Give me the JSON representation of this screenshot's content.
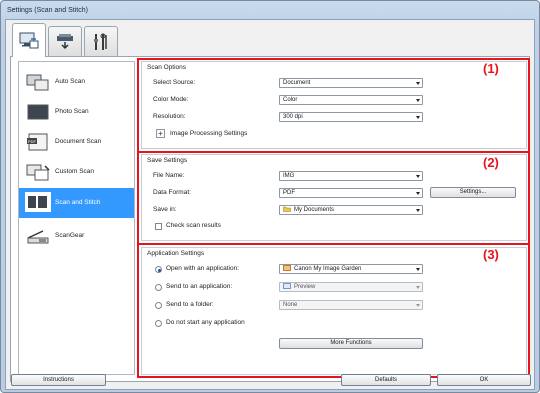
{
  "window": {
    "title": "Settings (Scan and Stitch)"
  },
  "tabs": [
    {
      "icon": "scan-from-computer-icon"
    },
    {
      "icon": "scan-from-panel-icon"
    },
    {
      "icon": "general-settings-icon"
    }
  ],
  "sidebar": {
    "items": [
      {
        "label": "Auto Scan",
        "icon": "auto-scan-icon"
      },
      {
        "label": "Photo Scan",
        "icon": "photo-scan-icon"
      },
      {
        "label": "Document Scan",
        "icon": "document-scan-icon"
      },
      {
        "label": "Custom Scan",
        "icon": "custom-scan-icon"
      },
      {
        "label": "Scan and Stitch",
        "icon": "scan-and-stitch-icon"
      },
      {
        "label": "ScanGear",
        "icon": "scangear-icon"
      }
    ]
  },
  "scan_options": {
    "title": "Scan Options",
    "select_source_label": "Select Source:",
    "select_source_value": "Document",
    "color_mode_label": "Color Mode:",
    "color_mode_value": "Color",
    "resolution_label": "Resolution:",
    "resolution_value": "300 dpi",
    "image_processing_label": "Image Processing Settings",
    "plus": "+"
  },
  "save_settings": {
    "title": "Save Settings",
    "file_name_label": "File Name:",
    "file_name_value": "IMG",
    "data_format_label": "Data Format:",
    "data_format_value": "PDF",
    "settings_button": "Settings...",
    "save_in_label": "Save in:",
    "save_in_value": "My Documents",
    "check_scan_results_label": "Check scan results"
  },
  "application_settings": {
    "title": "Application Settings",
    "open_with_label": "Open with an application:",
    "open_with_value": "Canon My Image Garden",
    "send_to_app_label": "Send to an application:",
    "send_to_app_value": "Preview",
    "send_to_folder_label": "Send to a folder:",
    "send_to_folder_value": "None",
    "do_not_start_label": "Do not start any application",
    "more_functions_button": "More Functions"
  },
  "callouts": {
    "one": "(1)",
    "two": "(2)",
    "three": "(3)"
  },
  "footer": {
    "instructions": "Instructions",
    "defaults": "Defaults",
    "ok": "OK"
  },
  "colors": {
    "accent_selected": "#3399ff",
    "callout_red": "#e8141c"
  }
}
